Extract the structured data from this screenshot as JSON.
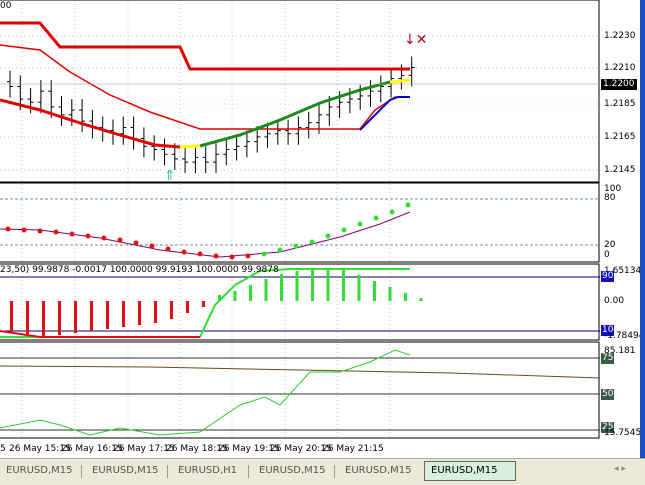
{
  "main": {
    "corner_label": "00",
    "price_labels": [
      "1.2230",
      "1.2210",
      "1.2185",
      "1.2165",
      "1.2145"
    ],
    "current_price": "1.2200",
    "closes": [
      1.2198,
      1.219,
      1.2188,
      1.2195,
      1.2185,
      1.218,
      1.2183,
      1.2176,
      1.2172,
      1.217,
      1.2168,
      1.2172,
      1.2165,
      1.216,
      1.2158,
      1.2155,
      1.2152,
      1.215,
      1.2153,
      1.215,
      1.2155,
      1.2158,
      1.216,
      1.2163,
      1.2166,
      1.2168,
      1.217,
      1.2168,
      1.2172,
      1.2175,
      1.218,
      1.2185,
      1.2188,
      1.219,
      1.2192,
      1.2195,
      1.2198,
      1.2203,
      1.2205,
      1.221
    ]
  },
  "stoch": {
    "labels": [
      "100",
      "80",
      "20",
      "0"
    ]
  },
  "osc": {
    "header": "23,50) 99.9878 -0.0017 100.0000 99.9193 100.0000 99.9878",
    "top_value": "1.65134",
    "zero": "0.00",
    "bottom_value": "-1.78494",
    "level_high": "90",
    "level_low": "10"
  },
  "rsi": {
    "max_value": "85.181",
    "min_value": "15.7545",
    "levels": [
      "75",
      "50",
      "25"
    ]
  },
  "time_axis": [
    "5",
    "26 May 15:15",
    "26 May 16:15",
    "26 May 17:15",
    "26 May 18:15",
    "26 May 19:15",
    "26 May 20:15",
    "26 May 21:15"
  ],
  "tabs": [
    {
      "label": "EURUSD,M15"
    },
    {
      "label": "EURUSD,M15"
    },
    {
      "label": "EURUSD,H1"
    },
    {
      "label": "EURUSD,M15"
    },
    {
      "label": "EURUSD,M15"
    },
    {
      "label": "EURUSD,M15",
      "active": true
    }
  ],
  "colors": {
    "envelope": "#e00000",
    "ma_up": "#1a8a1a",
    "signal": "#ffff00",
    "bull": "#33dd33",
    "bear": "#e01010",
    "axis_blue": "#1a4fc4"
  }
}
